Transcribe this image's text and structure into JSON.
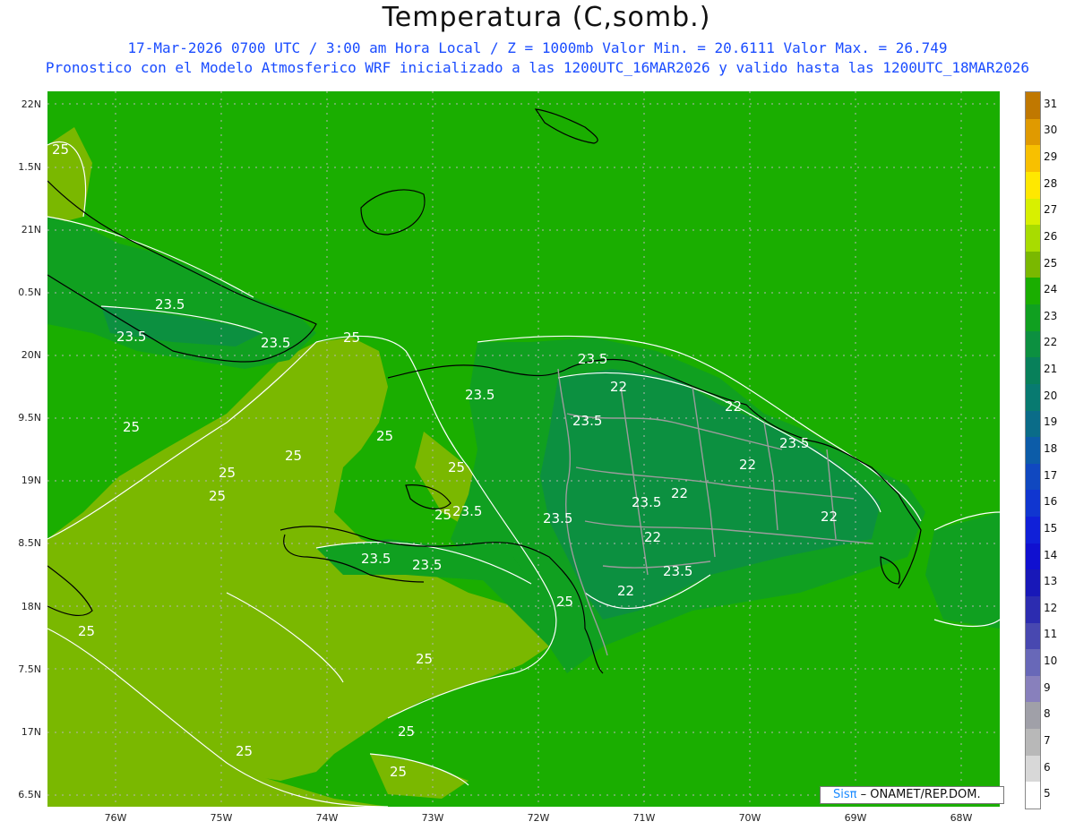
{
  "header": {
    "title": "Temperatura (C,somb.)",
    "line1": "17-Mar-2026  0700 UTC / 3:00 am Hora Local / Z = 1000mb   Valor Min. = 20.6111  Valor Max. = 26.749",
    "line2": "Pronostico con el Modelo Atmosferico WRF inicializado a las 1200UTC_16MAR2026 y valido hasta las  1200UTC_18MAR2026"
  },
  "axes": {
    "lat_labels": [
      "22N",
      "1.5N",
      "21N",
      "0.5N",
      "20N",
      "9.5N",
      "19N",
      "8.5N",
      "18N",
      "7.5N",
      "17N",
      "6.5N"
    ],
    "lon_labels": [
      "76W",
      "75W",
      "74W",
      "73W",
      "72W",
      "71W",
      "70W",
      "69W",
      "68W"
    ]
  },
  "colorbar": {
    "labels": [
      "31",
      "30",
      "29",
      "28",
      "27",
      "26",
      "25",
      "24",
      "23",
      "22",
      "21",
      "20",
      "19",
      "18",
      "17",
      "16",
      "15",
      "14",
      "13",
      "12",
      "11",
      "10",
      "9",
      "8",
      "7",
      "6",
      "5"
    ],
    "colors": [
      "#c07800",
      "#e09a00",
      "#f8c000",
      "#ffe800",
      "#d8f000",
      "#a8dc00",
      "#7ab800",
      "#1aae00",
      "#10a020",
      "#0c9040",
      "#08805a",
      "#087a70",
      "#0a6c88",
      "#0c5ca8",
      "#1048c0",
      "#1036d0",
      "#1020d8",
      "#1010d0",
      "#1818b8",
      "#2c2cb0",
      "#4848b0",
      "#6868b8",
      "#8880bc",
      "#a0a0a8",
      "#b8b8b8",
      "#d8d8d8",
      "#ffffff"
    ]
  },
  "contour_labels": [
    "25",
    "25",
    "23.5",
    "23.5",
    "23.5",
    "25",
    "23.5",
    "22",
    "23.5",
    "22",
    "25",
    "25",
    "25",
    "25",
    "23.5",
    "22",
    "23.5",
    "22",
    "25",
    "25",
    "23.5",
    "23.5",
    "23.5",
    "23.5",
    "22",
    "22",
    "23.5",
    "23.5",
    "25",
    "22",
    "25",
    "25",
    "25",
    "25",
    "25"
  ],
  "credit": {
    "brand": "Sisπ",
    "text": "– ONAMET/REP.DOM."
  }
}
